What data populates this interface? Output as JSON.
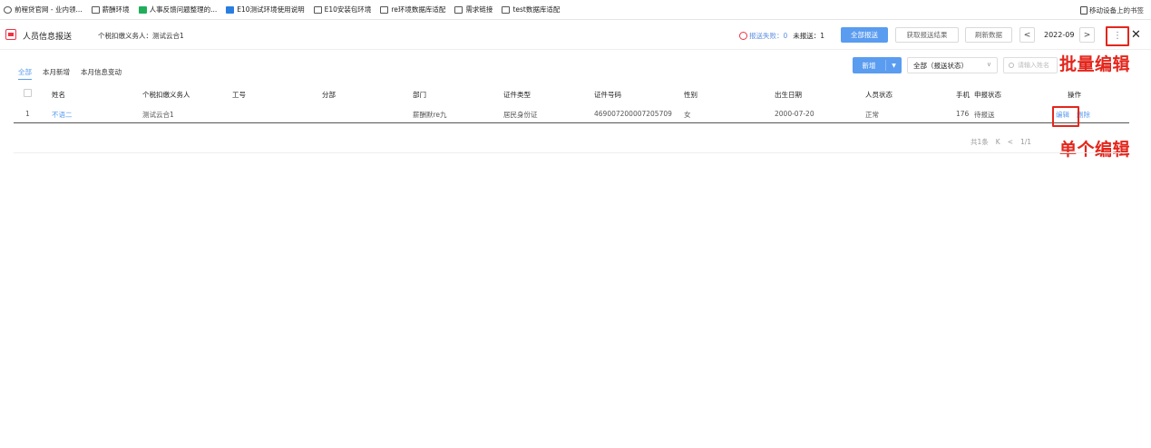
{
  "bookmarks": [
    {
      "label": "前程贷官网 - 业内领...",
      "icon": "globe-icon"
    },
    {
      "label": "薪酬环境",
      "icon": "folder-icon"
    },
    {
      "label": "人事反馈问题整理的...",
      "icon": "green-app-icon"
    },
    {
      "label": "E10测试环境使用说明",
      "icon": "blue-app-icon"
    },
    {
      "label": "E10安装包环境",
      "icon": "folder-icon"
    },
    {
      "label": "re环境数据库适配",
      "icon": "folder-icon"
    },
    {
      "label": "需求链接",
      "icon": "folder-icon"
    },
    {
      "label": "test数据库适配",
      "icon": "folder-icon"
    }
  ],
  "mobile_bookmarks": "移动设备上的书签",
  "header": {
    "title": "人员信息报送",
    "tax_agent_label": "个税扣缴义务人：测试云合1",
    "fail_text": "报送失败：0",
    "pending_text": "未报送：1",
    "send_all": "全部报送",
    "get_result": "获取报送结果",
    "refresh": "刷新数据",
    "prev": "<",
    "month": "2022-09",
    "next": ">",
    "more": "⋮",
    "close": "✕"
  },
  "tabs": [
    {
      "label": "全部",
      "active": true
    },
    {
      "label": "本月新增",
      "active": false
    },
    {
      "label": "本月信息变动",
      "active": false
    }
  ],
  "toolbar": {
    "add_label": "新增",
    "add_chevron": "▼",
    "status_select": "全部（报送状态）",
    "select_chevron": "∨",
    "search_placeholder": "请输入姓名"
  },
  "annotations": {
    "batch_edit": "批量编辑",
    "single_edit": "单个编辑"
  },
  "table": {
    "headers": [
      "姓名",
      "个税扣缴义务人",
      "工号",
      "分部",
      "部门",
      "证件类型",
      "证件号码",
      "性别",
      "出生日期",
      "人员状态",
      "手机",
      "申报状态",
      "操作"
    ],
    "rows": [
      {
        "index": "1",
        "name": "不语二",
        "tax_agent": "测试云合1",
        "job_no": "",
        "branch": "",
        "dept": "薪酬默re九",
        "id_type": "居民身份证",
        "id_no": "469007200007205709",
        "gender": "女",
        "birth": "2000-07-20",
        "status": "正常",
        "phone": "176",
        "report_status": "待报送",
        "edit": "编辑",
        "delete": "删除"
      }
    ]
  },
  "pager": {
    "total": "共1条",
    "first": "K",
    "prev": "<",
    "page": "1/1"
  },
  "colors": {
    "primary": "#5a9cf0",
    "annotation": "#e3261c"
  }
}
